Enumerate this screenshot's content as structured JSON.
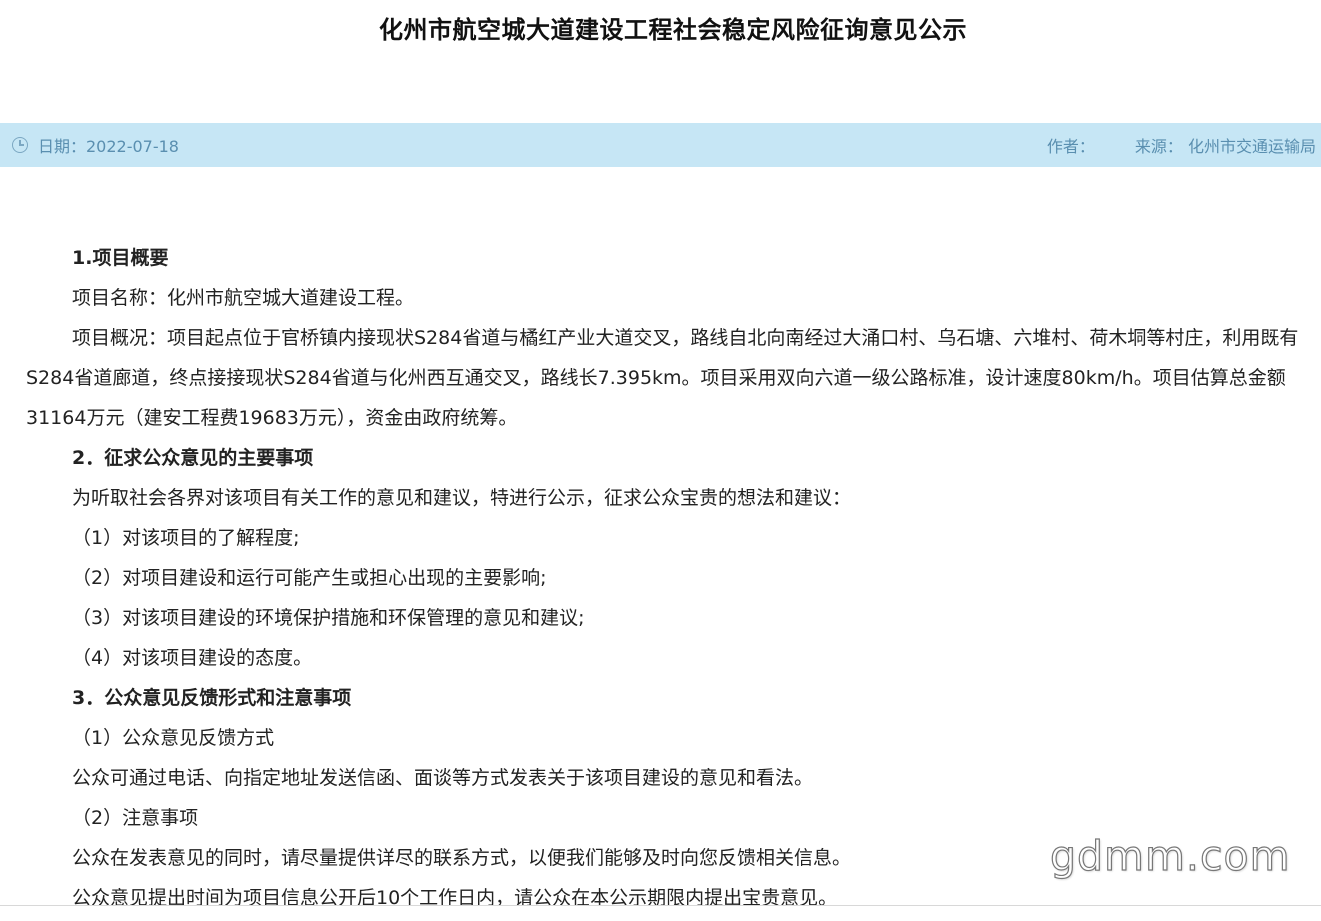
{
  "article": {
    "title": "化州市航空城大道建设工程社会稳定风险征询意见公示",
    "date": "日期：2022-07-18",
    "author": "作者：",
    "source": "来源：   化州市交通运输局"
  },
  "body": {
    "h1": "1.项目概要",
    "p1": "项目名称：化州市航空城大道建设工程。",
    "p2": "项目概况：项目起点位于官桥镇内接现状S284省道与橘红产业大道交叉，路线自北向南经过大涌口村、乌石塘、六堆村、荷木垌等村庄，利用既有S284省道廊道，终点接接现状S284省道与化州西互通交叉，路线长7.395km。项目采用双向六道一级公路标准，设计速度80km/h。项目估算总金额31164万元（建安工程费19683万元），资金由政府统筹。",
    "h2": "2．征求公众意见的主要事项",
    "p3": "为听取社会各界对该项目有关工作的意见和建议，特进行公示，征求公众宝贵的想法和建议：",
    "i1": "（1）对该项目的了解程度;",
    "i2": "（2）对项目建设和运行可能产生或担心出现的主要影响;",
    "i3": "（3）对该项目建设的环境保护措施和环保管理的意见和建议;",
    "i4": "（4）对该项目建设的态度。",
    "h3": "3．公众意见反馈形式和注意事项",
    "s1": "（1）公众意见反馈方式",
    "p4": "公众可通过电话、向指定地址发送信函、面谈等方式发表关于该项目建设的意见和看法。",
    "s2": "（2）注意事项",
    "p5": "公众在发表意见的同时，请尽量提供详尽的联系方式，以便我们能够及时向您反馈相关信息。",
    "p6": "公众意见提出时间为项目信息公开后10个工作日内，请公众在本公示期限内提出宝贵意见。"
  },
  "watermark": "gdmm.com"
}
